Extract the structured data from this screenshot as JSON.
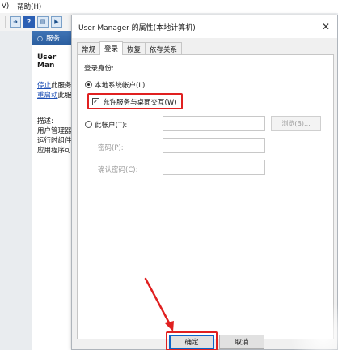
{
  "menubar": {
    "items": [
      "V)",
      "帮助(H)"
    ]
  },
  "services": {
    "header": "服务",
    "selected_name": "User Man",
    "links": [
      {
        "prefix": "停止",
        "suffix": "此服务"
      },
      {
        "prefix": "重启动",
        "suffix": "此服"
      }
    ],
    "desc_lines": [
      "描述:",
      "用户管理器",
      "运行时组件",
      "应用程序可"
    ]
  },
  "dialog": {
    "title": "User Manager 的属性(本地计算机)",
    "close": "✕",
    "tabs": [
      "常规",
      "登录",
      "恢复",
      "依存关系"
    ],
    "active_tab": 1,
    "logon_as_label": "登录身份:",
    "local_system_label": "本地系统帐户(L)",
    "allow_desktop_label": "允许服务与桌面交互(W)",
    "this_account_label": "此帐户(T):",
    "browse_label": "浏览(B)...",
    "password_label": "密码(P):",
    "confirm_password_label": "确认密码(C):",
    "ok_label": "确定",
    "cancel_label": "取消",
    "local_system_selected": true,
    "allow_desktop_checked": true
  },
  "colors": {
    "highlight": "#e02020",
    "accent": "#0a64c8",
    "link": "#1d4fb5"
  }
}
